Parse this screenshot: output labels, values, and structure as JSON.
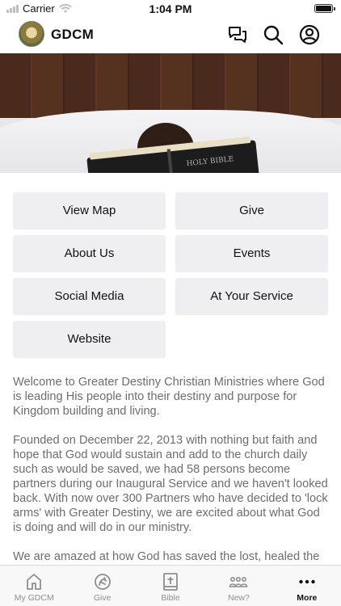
{
  "status_bar": {
    "carrier": "Carrier",
    "time": "1:04 PM",
    "battery_level": 1.0
  },
  "header": {
    "title": "GDCM",
    "icons": [
      "chat-bubbles-icon",
      "search-icon",
      "profile-icon"
    ]
  },
  "hero": {
    "book_text": "HOLY BIBLE"
  },
  "buttons": [
    {
      "label": "View Map"
    },
    {
      "label": "Give"
    },
    {
      "label": "About Us"
    },
    {
      "label": "Events"
    },
    {
      "label": "Social Media"
    },
    {
      "label": "At Your Service"
    },
    {
      "label": "Website"
    }
  ],
  "content": {
    "paragraphs": [
      "Welcome to Greater Destiny Christian Ministries where God is leading His people into their destiny and purpose for Kingdom building and living.",
      "Founded on December 22, 2013 with nothing but faith and hope that God would sustain and add to the church daily such as would be saved, we had 58 persons become partners during our Inaugural Service and we haven't looked back. With now over 300 Partners who have decided to 'lock arms' with Greater Destiny, we are excited about what God is doing and will do in our ministry.",
      "We are amazed at how God has saved the lost, healed the brokenhearted, reclaimed the backslider and allowed"
    ]
  },
  "tabs": [
    {
      "label": "My GDCM",
      "icon": "home-icon",
      "active": false
    },
    {
      "label": "Give",
      "icon": "give-icon",
      "active": false
    },
    {
      "label": "Bible",
      "icon": "bible-icon",
      "active": false
    },
    {
      "label": "New?",
      "icon": "people-icon",
      "active": false
    },
    {
      "label": "More",
      "icon": "more-icon",
      "active": true
    }
  ]
}
